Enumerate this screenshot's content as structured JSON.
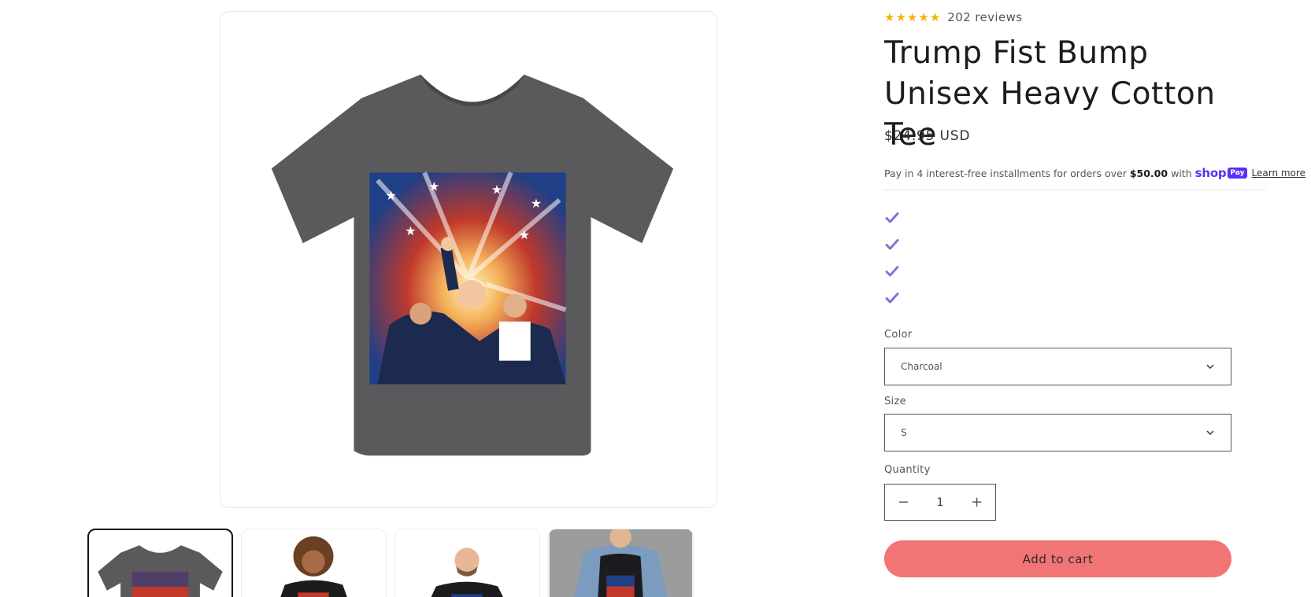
{
  "product": {
    "rating_stars": 5,
    "reviews_text": "202 reviews",
    "title": "Trump Fist Bump Unisex Heavy Cotton Tee",
    "price": "$24.95 USD"
  },
  "installments": {
    "text_before": "Pay in 4 interest-free installments for orders over",
    "threshold": "$50.00",
    "text_after": "with",
    "shop_logo": "shop",
    "pay_badge": "Pay",
    "learn_more": "Learn more"
  },
  "options": {
    "color_label": "Color",
    "color_value": "Charcoal",
    "size_label": "Size",
    "size_value": "S",
    "quantity_label": "Quantity",
    "quantity_value": "1",
    "minus_symbol": "−",
    "plus_symbol": "+"
  },
  "cart": {
    "add_to_cart": "Add to cart"
  },
  "colors": {
    "accent_check": "#8a6fd1",
    "add_to_cart_bg": "#f07574",
    "star": "#f5b301",
    "shop_pay": "#5a31f4",
    "shirt_charcoal": "#5a5a5d",
    "shirt_black": "#1c1c1e"
  },
  "icons": {
    "star": "star-icon",
    "check": "check-icon",
    "chevron": "chevron-down-icon"
  }
}
